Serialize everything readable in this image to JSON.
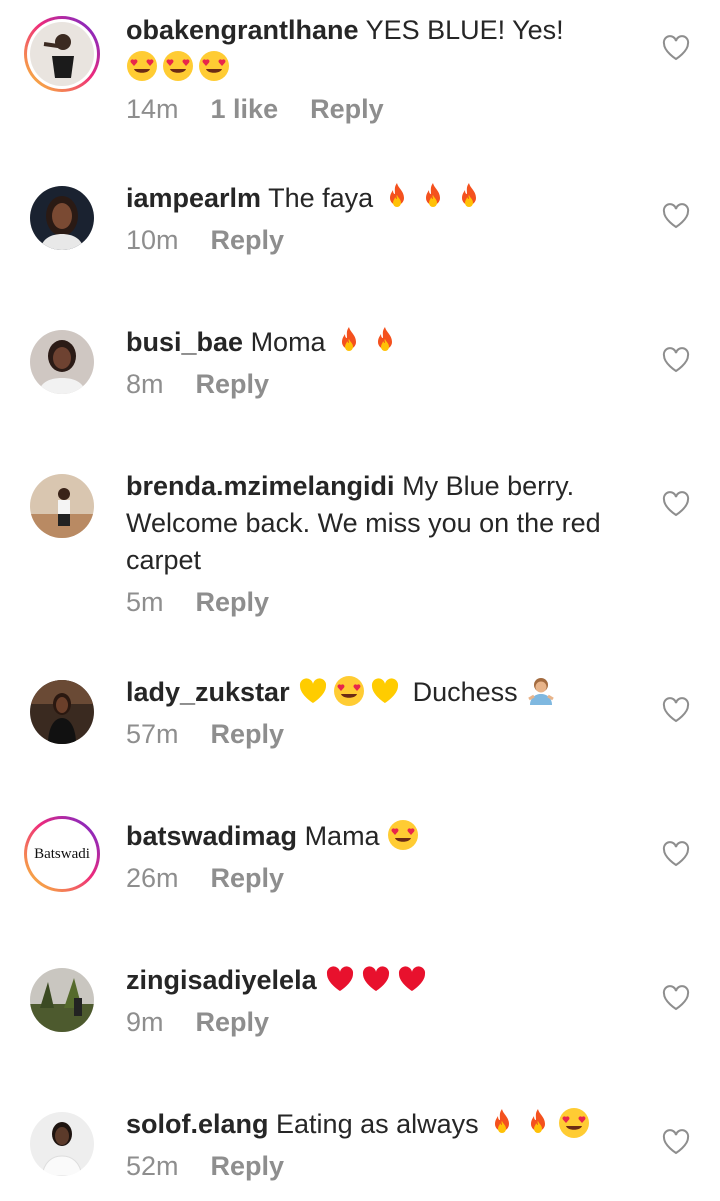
{
  "comments": [
    {
      "username": "obakengrantlhane",
      "text": "YES BLUE! Yes!",
      "emojis_after_text": [
        "heart-eyes",
        "heart-eyes",
        "heart-eyes"
      ],
      "time": "14m",
      "likes": "1 like",
      "reply_label": "Reply",
      "has_story_ring": true
    },
    {
      "username": "iampearlm",
      "text": "The faya",
      "emojis_after_text": [
        "fire",
        "fire",
        "fire"
      ],
      "time": "10m",
      "reply_label": "Reply"
    },
    {
      "username": "busi_bae",
      "text": "Moma",
      "emojis_after_text": [
        "fire",
        "fire"
      ],
      "time": "8m",
      "reply_label": "Reply"
    },
    {
      "username": "brenda.mzimelangidi",
      "text": "My Blue berry. Welcome back. We miss you on the red carpet",
      "time": "5m",
      "reply_label": "Reply"
    },
    {
      "username": "lady_zukstar",
      "emojis_before_text": [
        "yellow-heart",
        "heart-eyes",
        "yellow-heart"
      ],
      "text": "Duchess",
      "emojis_after_text": [
        "person-shrugging"
      ],
      "time": "57m",
      "reply_label": "Reply"
    },
    {
      "username": "batswadimag",
      "text": "Mama",
      "emojis_after_text": [
        "heart-eyes"
      ],
      "time": "26m",
      "reply_label": "Reply",
      "avatar_text": "Batswadi",
      "has_story_ring": true
    },
    {
      "username": "zingisadiyelela",
      "text": "",
      "emojis_after_text": [
        "red-heart",
        "red-heart",
        "red-heart"
      ],
      "time": "9m",
      "reply_label": "Reply"
    },
    {
      "username": "solof.elang",
      "text": "Eating as always",
      "emojis_after_text": [
        "fire",
        "fire",
        "heart-eyes"
      ],
      "time": "52m",
      "reply_label": "Reply"
    }
  ],
  "colors": {
    "text": "#262626",
    "meta": "#8e8e8e",
    "ring_start": "#f9ce34",
    "ring_mid": "#ee2a7b",
    "ring_end": "#6228d7"
  }
}
